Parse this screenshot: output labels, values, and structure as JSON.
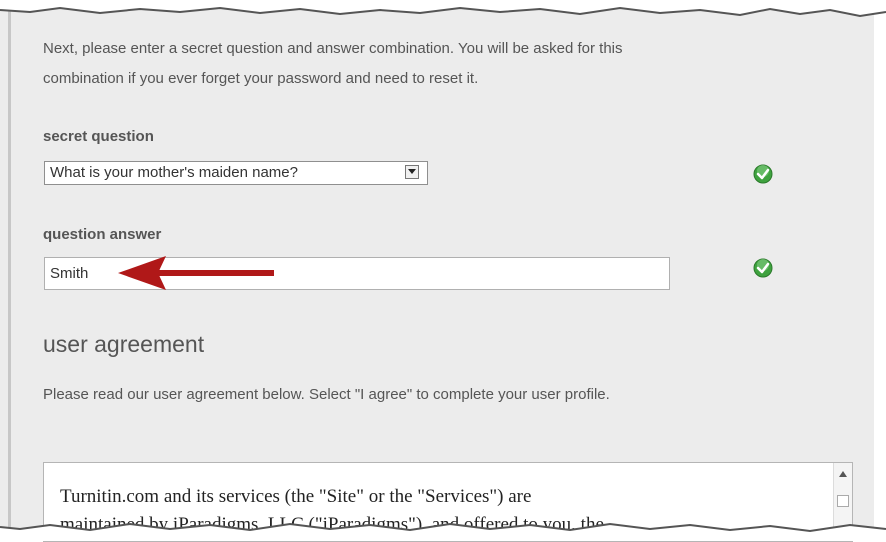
{
  "intro": {
    "line1": "Next, please enter a secret question and answer combination. You will be asked for this",
    "line2": "combination if you ever forget your password and need to reset it."
  },
  "secret_question": {
    "label": "secret question",
    "selected": "What is your mother's maiden name?"
  },
  "question_answer": {
    "label": "question answer",
    "value": "Smith"
  },
  "user_agreement": {
    "heading": "user agreement",
    "note": "Please read our user agreement below. Select \"I agree\" to complete your user profile.",
    "text_line1": "Turnitin.com and its services (the \"Site\" or the \"Services\") are",
    "text_line2": "maintained by iParadigms, LLC (\"iParadigms\"), and offered to you, the"
  },
  "colors": {
    "check_green": "#3fa23f",
    "arrow_red": "#b01818"
  }
}
